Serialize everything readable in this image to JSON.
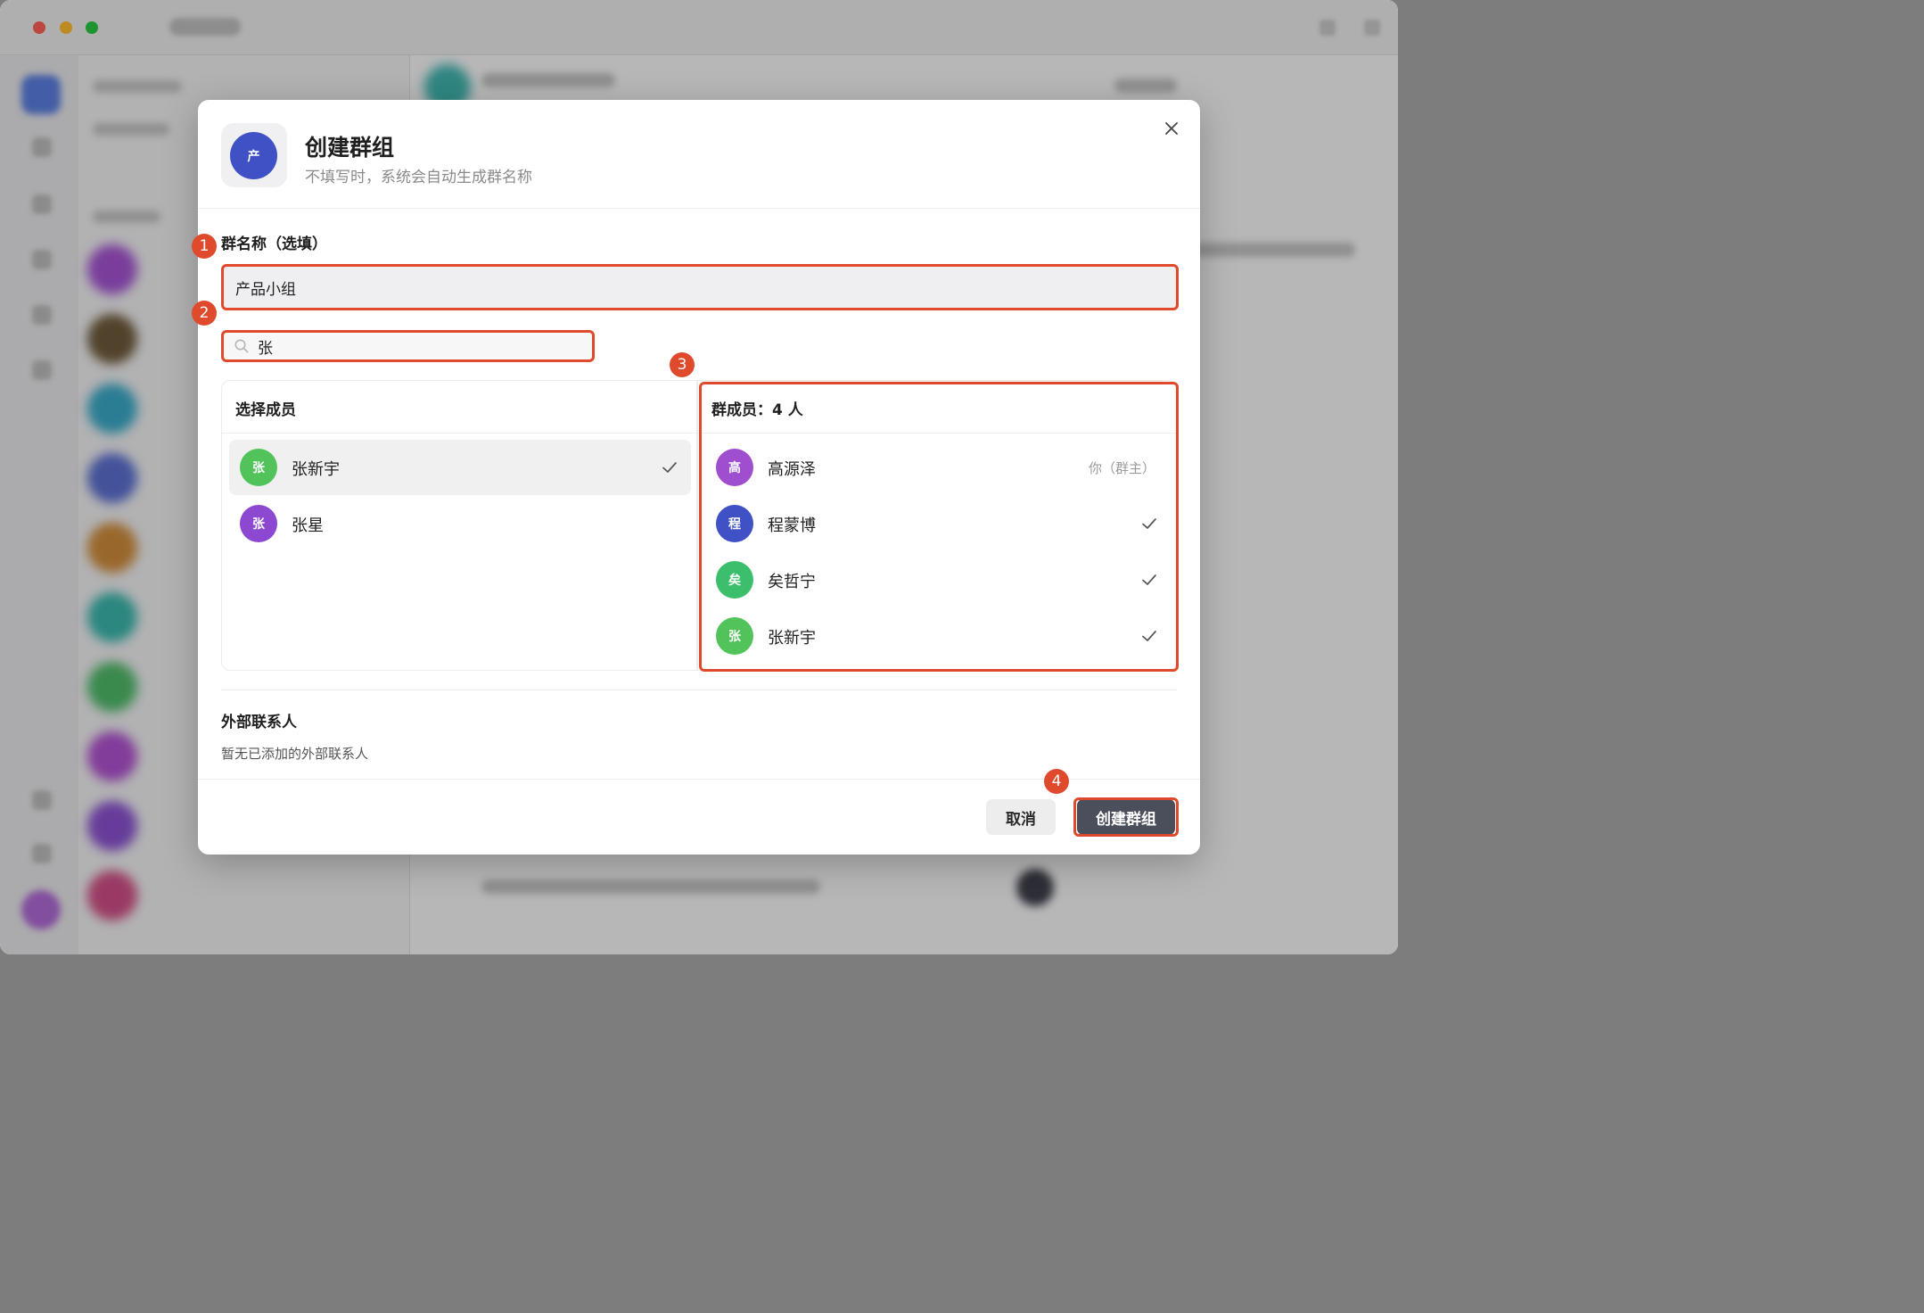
{
  "colors": {
    "accent": "#4b4f5c",
    "annotation": "#e04a2c",
    "group_avatar": "#3f51c4",
    "avatar_green": "#52c25a",
    "avatar_purple": "#8c48d0",
    "avatar_indigo": "#3f51c4",
    "avatar_teal_green": "#3cbf6c"
  },
  "dialog": {
    "avatar_char": "产",
    "title": "创建群组",
    "subtitle": "不填写时，系统会自动生成群名称",
    "close_icon": "close-icon"
  },
  "group_name": {
    "label": "群名称（选填）",
    "value": "产品小组"
  },
  "search": {
    "value": "张",
    "icon": "search-icon"
  },
  "select_members": {
    "title": "选择成员",
    "items": [
      {
        "avatar": "张",
        "name": "张新宇",
        "selected": true
      },
      {
        "avatar": "张",
        "name": "张星",
        "selected": false
      }
    ]
  },
  "group_members": {
    "title": "群成员：4 人",
    "items": [
      {
        "avatar": "高",
        "name": "高源泽",
        "role": "你（群主）"
      },
      {
        "avatar": "程",
        "name": "程蒙博"
      },
      {
        "avatar": "矣",
        "name": "矣哲宁"
      },
      {
        "avatar": "张",
        "name": "张新宇"
      }
    ]
  },
  "external": {
    "title": "外部联系人",
    "empty_text": "暂无已添加的外部联系人"
  },
  "buttons": {
    "cancel": "取消",
    "create": "创建群组"
  },
  "annotations": [
    "1",
    "2",
    "3",
    "4"
  ]
}
